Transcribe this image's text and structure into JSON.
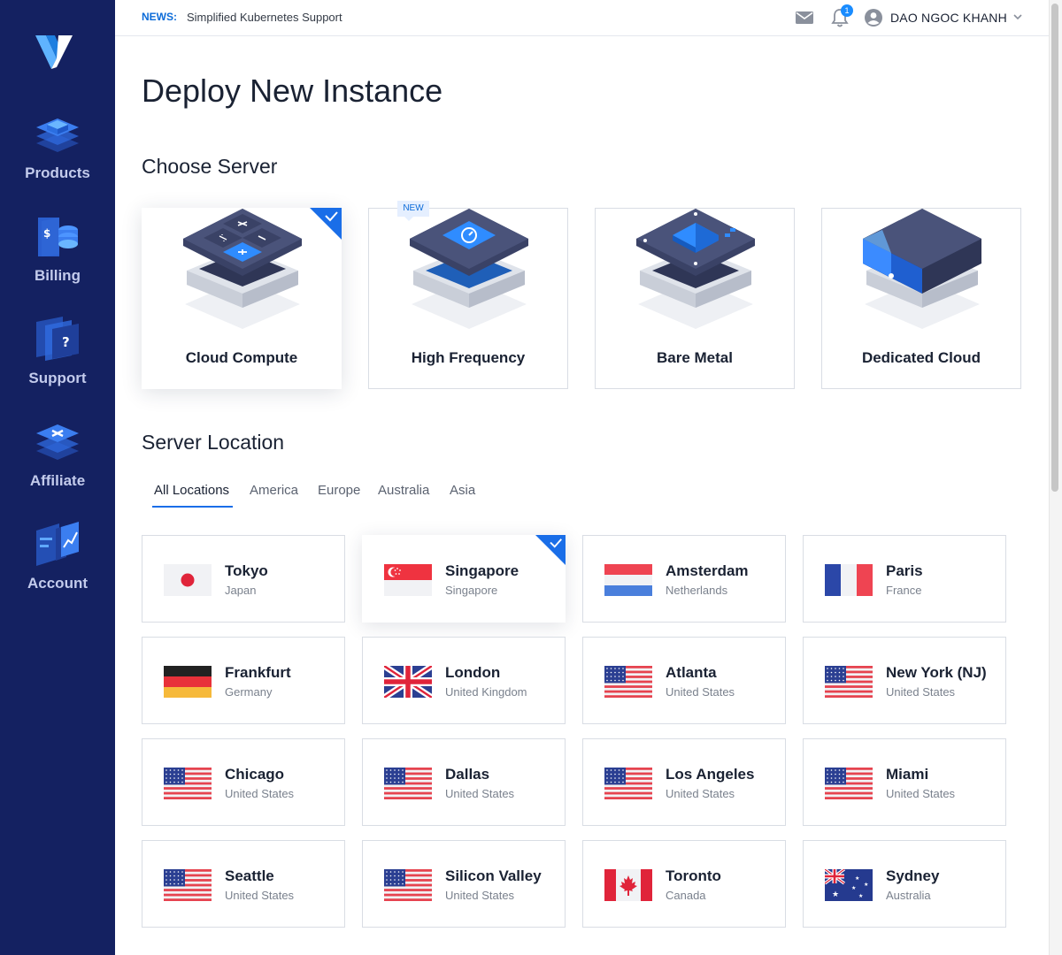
{
  "news": {
    "tag": "NEWS:",
    "text": "Simplified Kubernetes Support"
  },
  "header": {
    "user_name": "DAO NGOC KHANH",
    "notification_count": "1"
  },
  "sidebar": {
    "items": [
      {
        "label": "Products",
        "icon": "products-icon"
      },
      {
        "label": "Billing",
        "icon": "billing-icon"
      },
      {
        "label": "Support",
        "icon": "support-icon"
      },
      {
        "label": "Affiliate",
        "icon": "affiliate-icon"
      },
      {
        "label": "Account",
        "icon": "account-icon"
      }
    ]
  },
  "page": {
    "title": "Deploy New Instance"
  },
  "choose_server": {
    "title": "Choose Server",
    "new_badge": "NEW",
    "options": [
      {
        "label": "Cloud Compute",
        "selected": true
      },
      {
        "label": "High Frequency",
        "badge": "NEW"
      },
      {
        "label": "Bare Metal"
      },
      {
        "label": "Dedicated Cloud"
      }
    ]
  },
  "server_location": {
    "title": "Server Location",
    "tabs": [
      {
        "label": "All Locations",
        "active": true
      },
      {
        "label": "America"
      },
      {
        "label": "Europe"
      },
      {
        "label": "Australia"
      },
      {
        "label": "Asia"
      }
    ],
    "locations": [
      {
        "city": "Tokyo",
        "country": "Japan",
        "flag": "japan-flag"
      },
      {
        "city": "Singapore",
        "country": "Singapore",
        "flag": "singapore-flag",
        "selected": true
      },
      {
        "city": "Amsterdam",
        "country": "Netherlands",
        "flag": "netherlands-flag"
      },
      {
        "city": "Paris",
        "country": "France",
        "flag": "france-flag"
      },
      {
        "city": "Frankfurt",
        "country": "Germany",
        "flag": "germany-flag"
      },
      {
        "city": "London",
        "country": "United Kingdom",
        "flag": "uk-flag"
      },
      {
        "city": "Atlanta",
        "country": "United States",
        "flag": "us-flag"
      },
      {
        "city": "New York (NJ)",
        "country": "United States",
        "flag": "us-flag"
      },
      {
        "city": "Chicago",
        "country": "United States",
        "flag": "us-flag"
      },
      {
        "city": "Dallas",
        "country": "United States",
        "flag": "us-flag"
      },
      {
        "city": "Los Angeles",
        "country": "United States",
        "flag": "us-flag"
      },
      {
        "city": "Miami",
        "country": "United States",
        "flag": "us-flag"
      },
      {
        "city": "Seattle",
        "country": "United States",
        "flag": "us-flag"
      },
      {
        "city": "Silicon Valley",
        "country": "United States",
        "flag": "us-flag"
      },
      {
        "city": "Toronto",
        "country": "Canada",
        "flag": "canada-flag"
      },
      {
        "city": "Sydney",
        "country": "Australia",
        "flag": "australia-flag"
      }
    ]
  },
  "colors": {
    "sidebar": "#142161",
    "accent": "#1a6ee8",
    "news": "#0b6bd8"
  }
}
